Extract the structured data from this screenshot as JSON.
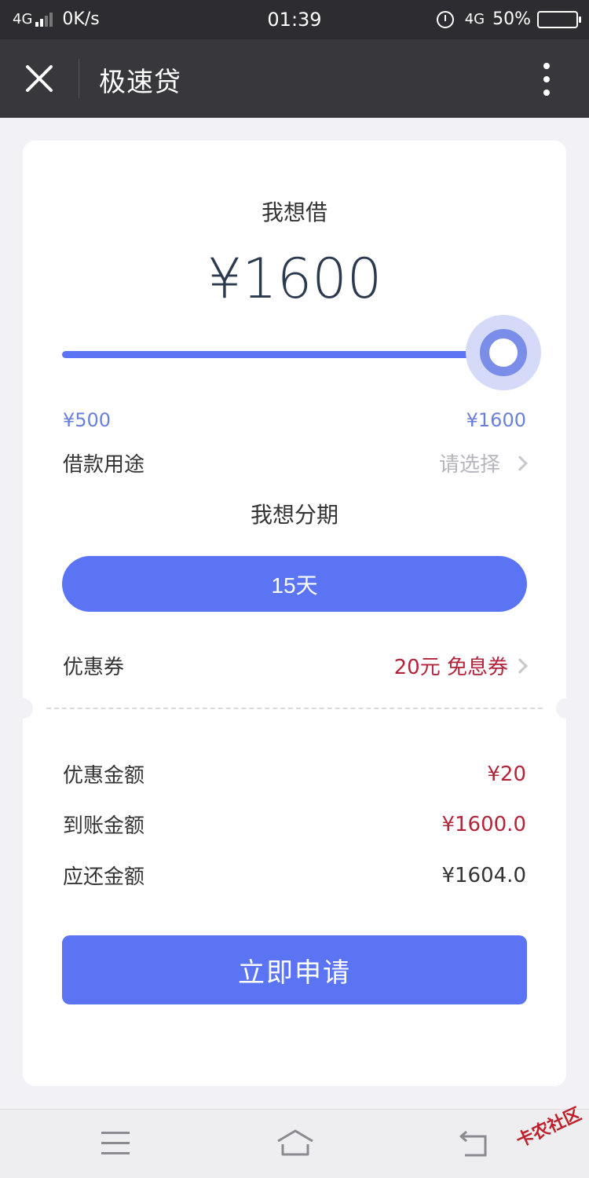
{
  "status_bar": {
    "network_left": "4G",
    "speed": "0K/s",
    "time": "01:39",
    "network_right": "4G",
    "battery": "50%",
    "battery_level": 0.5
  },
  "nav": {
    "title": "极速贷"
  },
  "loan": {
    "want_label": "我想借",
    "amount": "¥1600",
    "min": "¥500",
    "max": "¥1600",
    "slider_fraction": 1.0
  },
  "purpose": {
    "label": "借款用途",
    "placeholder": "请选择"
  },
  "installment": {
    "title": "我想分期",
    "selected": "15天"
  },
  "coupon": {
    "label": "优惠券",
    "value": "20元 免息券"
  },
  "summary": {
    "discount_label": "优惠金额",
    "discount_value": "¥20",
    "arrival_label": "到账金额",
    "arrival_value": "¥1600.0",
    "repay_label": "应还金额",
    "repay_value": "¥1604.0"
  },
  "apply_button": "立即申请",
  "watermark": "卡农社区",
  "colors": {
    "accent": "#5b74f4",
    "highlight_red": "#b3243a"
  }
}
